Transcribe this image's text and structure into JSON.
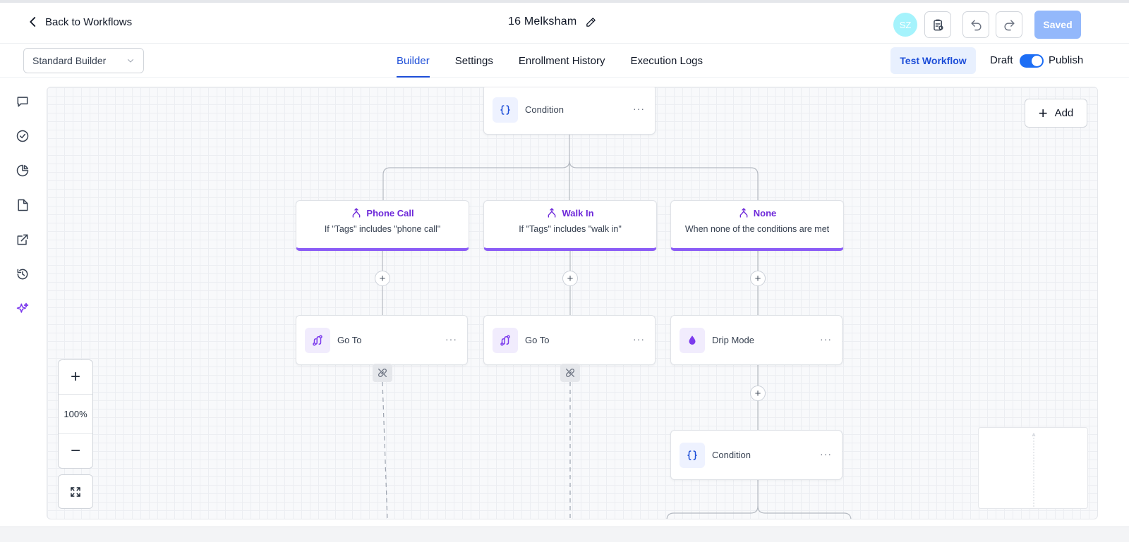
{
  "header": {
    "back_label": "Back to Workflows",
    "workflow_name": "16 Melksham",
    "avatar_initials": "SZ",
    "saved_label": "Saved"
  },
  "subheader": {
    "builder_select_value": "Standard Builder",
    "tabs": [
      {
        "label": "Builder",
        "active": true
      },
      {
        "label": "Settings",
        "active": false
      },
      {
        "label": "Enrollment History",
        "active": false
      },
      {
        "label": "Execution Logs",
        "active": false
      }
    ],
    "test_label": "Test Workflow",
    "draft_label": "Draft",
    "publish_label": "Publish",
    "publish_toggle_on": true
  },
  "rail": {
    "icons": [
      "chat-icon",
      "check-circle-icon",
      "pie-chart-icon",
      "file-icon",
      "external-link-icon",
      "history-icon",
      "sparkles-icon"
    ]
  },
  "canvas": {
    "add_label": "Add",
    "zoom_level": "100%",
    "nodes": {
      "condition_top": {
        "label": "Condition"
      },
      "branches": [
        {
          "title": "Phone Call",
          "subtitle": "If \"Tags\" includes \"phone call\""
        },
        {
          "title": "Walk In",
          "subtitle": "If \"Tags\" includes \"walk in\""
        },
        {
          "title": "None",
          "subtitle": "When none of the conditions are met"
        }
      ],
      "goto_1": {
        "label": "Go To"
      },
      "goto_2": {
        "label": "Go To"
      },
      "drip": {
        "label": "Drip Mode"
      },
      "condition_bottom": {
        "label": "Condition"
      }
    }
  },
  "colors": {
    "accent": "#1d4ed8",
    "branch_purple": "#8b5cf6",
    "saved_button": "#93b8fb"
  }
}
